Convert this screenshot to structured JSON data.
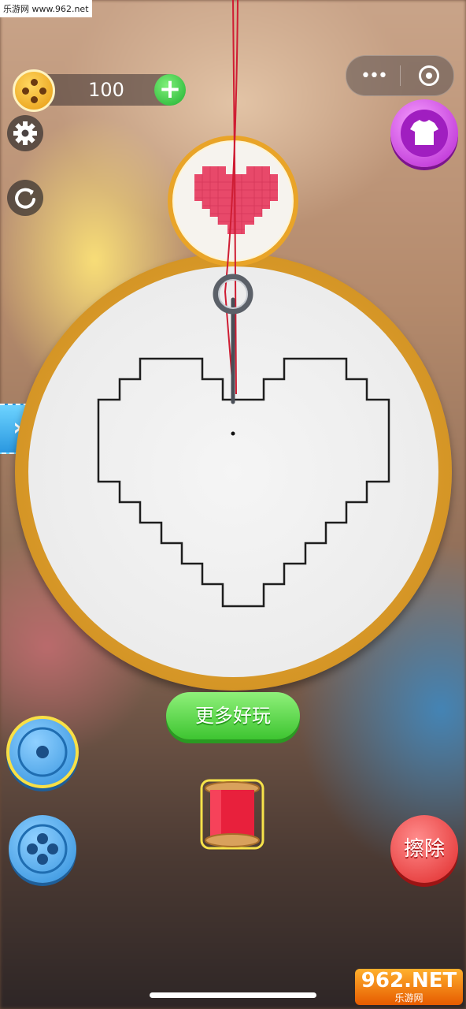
{
  "watermark_top": "乐游网 www.962.net",
  "coins": {
    "count": "100",
    "plus_label": "+"
  },
  "capsule": {
    "more_label": "•••"
  },
  "more_games_label": "更多好玩",
  "erase_label": "擦除",
  "fast_forward_label": "»",
  "watermark_bottom": {
    "brand": "962.NET",
    "sub": "乐游网"
  },
  "pattern": {
    "name": "heart",
    "thread_color": "#d5223a",
    "preview_color": "#e8496a"
  },
  "colors": {
    "hoop": "#e9a428",
    "accent_green": "#3ec531",
    "accent_blue": "#2f8fdc",
    "accent_purple": "#b422d0",
    "accent_red": "#e02a2a"
  }
}
